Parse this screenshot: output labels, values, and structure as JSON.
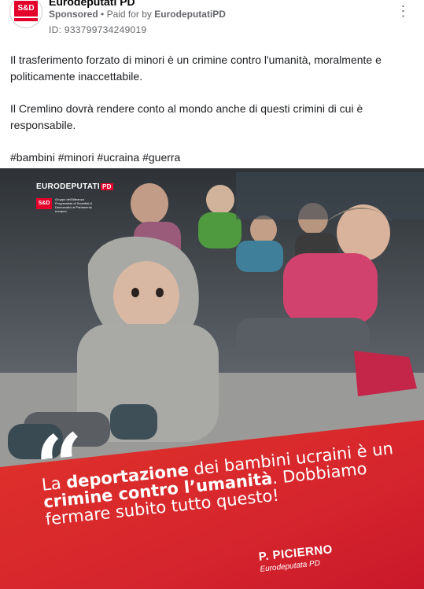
{
  "post": {
    "page_name": "Eurodeputati PD",
    "sponsored_label": "Sponsored",
    "separator": "•",
    "paid_for_prefix": "Paid for by",
    "paid_for_by": "EurodeputatiPD",
    "ad_id": "ID: 933799734249019",
    "more_options": "⋮",
    "avatar_badge": "S&D"
  },
  "text": {
    "paragraph1": "Il trasferimento forzato di minori è un crimine contro l'umanità, moralmente e politicamente inaccettabile.",
    "paragraph2": "Il Cremlino dovrà rendere conto al mondo anche di questi crimini di cui è responsabile.",
    "hashtags": "#bambini #minori #ucraina #guerra"
  },
  "creative": {
    "logo_text": "EURODEPUTATI",
    "logo_badge": "PD",
    "sd_badge": "S&D",
    "sd_caption": "Gruppo dell'Alleanza Progressista di Socialisti & Democratici al Parlamento europeo",
    "quote_mark": "“",
    "quote_part1": "La ",
    "quote_bold1": "deportazione",
    "quote_part2": " dei bambini ucraini è un ",
    "quote_bold2": "crimine contro l’umanità",
    "quote_part3": ". Dobbiamo fermare subito tutto questo!",
    "signature_name": "P. PICIERNO",
    "signature_role": "Eurodeputata PD"
  },
  "colors": {
    "accent_red": "#e4002b",
    "banner_red": "#d9262e",
    "meta_gray": "#65676b"
  }
}
